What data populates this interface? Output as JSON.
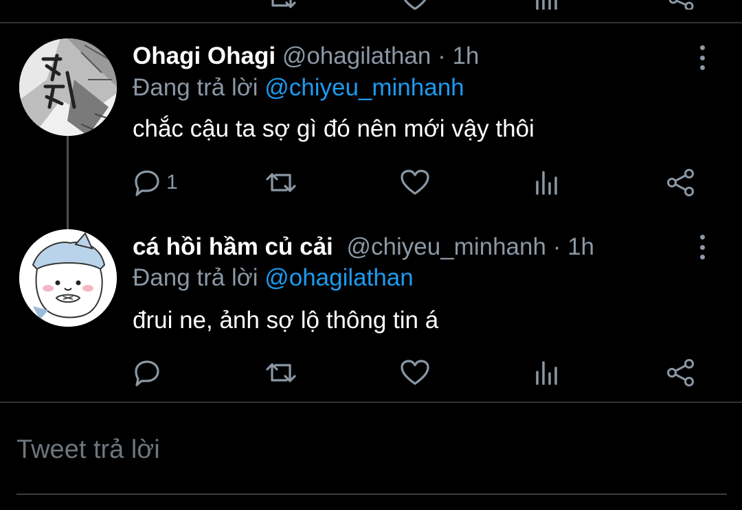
{
  "colors": {
    "background": "#000000",
    "primary_text": "#ffffff",
    "secondary_text": "#8b98a5",
    "mention": "#1d9bf0",
    "divider": "#2f3336"
  },
  "tweets": [
    {
      "display_name": "Ohagi Ohagi",
      "handle": "@ohagilathan",
      "separator": "·",
      "time": "1h",
      "reply_prefix": "Đang trả lời",
      "reply_to": "@chiyeu_minhanh",
      "text": "chắc cậu ta sợ gì đó nên mới vậy thôi",
      "reply_count": "1",
      "avatar_icon": "manga-avatar-icon"
    },
    {
      "display_name": "cá hồi hầm củ cải",
      "handle": "@chiyeu_minhanh",
      "separator": "·",
      "time": "1h",
      "reply_prefix": "Đang trả lời",
      "reply_to": "@ohagilathan",
      "text": "đrui ne, ảnh sợ lộ thông tin á",
      "reply_count": "",
      "avatar_icon": "chiikawa-avatar-icon"
    }
  ],
  "actions": {
    "icons": [
      "reply-icon",
      "retweet-icon",
      "like-icon",
      "analytics-icon",
      "share-icon"
    ]
  },
  "composer": {
    "placeholder": "Tweet trả lời"
  }
}
